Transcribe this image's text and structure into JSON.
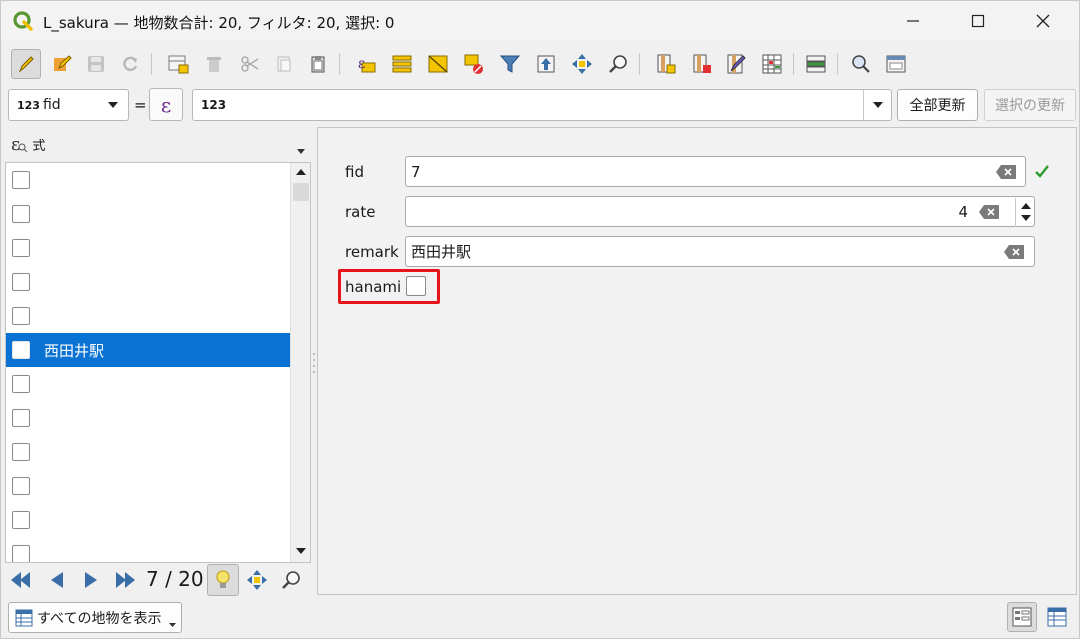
{
  "window": {
    "title": "L_sakura — 地物数合計: 20, フィルタ: 20, 選択: 0"
  },
  "toolbar": {
    "icons": [
      "toggle-editing-icon",
      "edit-icon",
      "save-icon",
      "reload-icon",
      "add-feature-icon",
      "delete-feature-icon",
      "cut-icon",
      "copy-icon",
      "paste-icon",
      "select-by-expression-icon",
      "select-all-icon",
      "invert-selection-icon",
      "deselect-icon",
      "filter-icon",
      "move-to-top-icon",
      "pan-to-selection-icon",
      "zoom-to-selection-icon",
      "new-field-icon",
      "delete-field-icon",
      "field-calculator-icon",
      "conditional-formatting-icon",
      "actions-icon",
      "dock-icon",
      "organize-columns-icon"
    ]
  },
  "filter": {
    "field_type": "123",
    "field_name": "fid",
    "operator": "=",
    "value": "123",
    "update_all_label": "全部更新",
    "update_selected_label": "選択の更新"
  },
  "left_panel": {
    "sort_label": "式",
    "items": [
      {
        "label": "",
        "selected": false
      },
      {
        "label": "",
        "selected": false
      },
      {
        "label": "",
        "selected": false
      },
      {
        "label": "",
        "selected": false
      },
      {
        "label": "",
        "selected": false
      },
      {
        "label": "西田井駅",
        "selected": true
      },
      {
        "label": "",
        "selected": false
      },
      {
        "label": "",
        "selected": false
      },
      {
        "label": "",
        "selected": false
      },
      {
        "label": "",
        "selected": false
      },
      {
        "label": "",
        "selected": false
      },
      {
        "label": "",
        "selected": false
      }
    ],
    "nav": {
      "counter": "7 / 20"
    }
  },
  "form": {
    "fid": {
      "label": "fid",
      "value": "7"
    },
    "rate": {
      "label": "rate",
      "value": "4"
    },
    "remark": {
      "label": "remark",
      "value": "西田井駅"
    },
    "hanami": {
      "label": "hanami",
      "checked": false
    }
  },
  "bottom": {
    "show_features_label": "すべての地物を表示"
  },
  "colors": {
    "selection": "#0a72d2",
    "highlight_box": "#e8141c",
    "valid_check": "#2e9a2e"
  }
}
